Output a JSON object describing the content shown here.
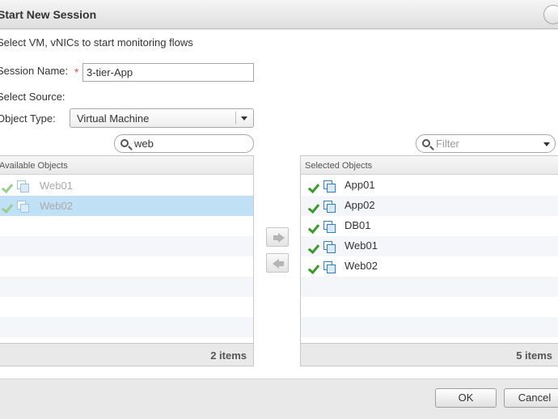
{
  "dialog": {
    "title": "Start New Session",
    "instructions": "Select VM, vNICs to start monitoring flows"
  },
  "form": {
    "session_name_label": "Session Name:",
    "required_marker": "*",
    "session_name_value": "3-tier-App",
    "select_source_label": "Select Source:",
    "object_type_label": "Object Type:",
    "object_type_value": "Virtual Machine"
  },
  "available": {
    "search_value": "web",
    "header": "Available Objects",
    "items": [
      {
        "name": "Web01",
        "status_icon": "check-icon",
        "type_icon": "vm-icon"
      },
      {
        "name": "Web02",
        "status_icon": "check-icon",
        "type_icon": "vm-icon",
        "selected": true
      }
    ],
    "count_label": "2 items"
  },
  "selected": {
    "filter_placeholder": "Filter",
    "header": "Selected Objects",
    "items": [
      {
        "name": "App01",
        "status_icon": "check-icon",
        "type_icon": "vm-icon"
      },
      {
        "name": "App02",
        "status_icon": "check-icon",
        "type_icon": "vm-icon"
      },
      {
        "name": "DB01",
        "status_icon": "check-icon",
        "type_icon": "vm-icon"
      },
      {
        "name": "Web01",
        "status_icon": "check-icon",
        "type_icon": "vm-icon"
      },
      {
        "name": "Web02",
        "status_icon": "check-icon",
        "type_icon": "vm-icon"
      }
    ],
    "count_label": "5 items"
  },
  "transfer": {
    "add_icon": "arrow-right-icon",
    "remove_icon": "arrow-left-icon"
  },
  "buttons": {
    "ok": "OK",
    "cancel": "Cancel"
  },
  "colors": {
    "selection": "#bfe0f5",
    "check": "#3a9a2c",
    "vm_icon": "#2f7fc1",
    "required": "#d9534f"
  }
}
